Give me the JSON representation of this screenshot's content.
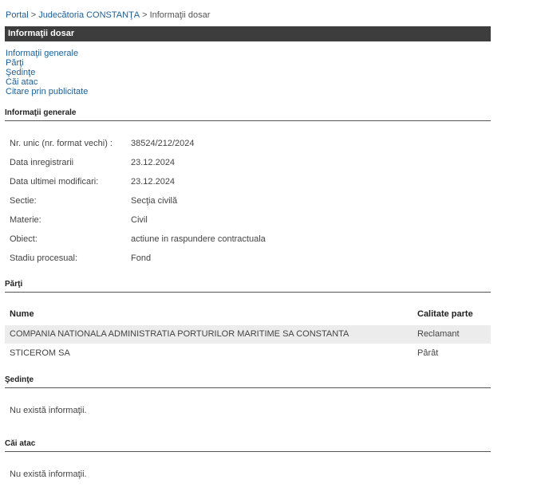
{
  "breadcrumb": {
    "items": [
      "Portal",
      "Judecătoria CONSTANŢA",
      "Informaţii dosar"
    ],
    "separator": ">"
  },
  "page_title": "Informaţii dosar",
  "anchors": [
    "Informaţii generale",
    "Părţi",
    "Şedinţe",
    "Căi atac",
    "Citare prin publicitate"
  ],
  "info": {
    "heading": "Informaţii generale",
    "rows": [
      {
        "label": "Nr. unic (nr. format vechi) :",
        "value": "38524/212/2024"
      },
      {
        "label": "Data inregistrarii",
        "value": "23.12.2024"
      },
      {
        "label": "Data ultimei modificari:",
        "value": "23.12.2024"
      },
      {
        "label": "Sectie:",
        "value": "Secţia civilă"
      },
      {
        "label": "Materie:",
        "value": "Civil"
      },
      {
        "label": "Obiect:",
        "value": "actiune in raspundere contractuala"
      },
      {
        "label": "Stadiu procesual:",
        "value": "Fond"
      }
    ]
  },
  "parti": {
    "heading": "Părţi",
    "col_name": "Nume",
    "col_calitate": "Calitate parte",
    "rows": [
      {
        "nume": "COMPANIA NATIONALA ADMINISTRATIA PORTURILOR MARITIME SA CONSTANTA",
        "calitate": "Reclamant"
      },
      {
        "nume": "STICEROM SA",
        "calitate": "Pârât"
      }
    ]
  },
  "sedinte": {
    "heading": "Şedinţe",
    "empty_text": "Nu există informaţii."
  },
  "cai_atac": {
    "heading": "Căi atac",
    "empty_text": "Nu există informaţii."
  },
  "colors": {
    "link": "#1b5f97",
    "titlebar_bg": "#3d3d3d",
    "row_alt": "#ececec"
  }
}
